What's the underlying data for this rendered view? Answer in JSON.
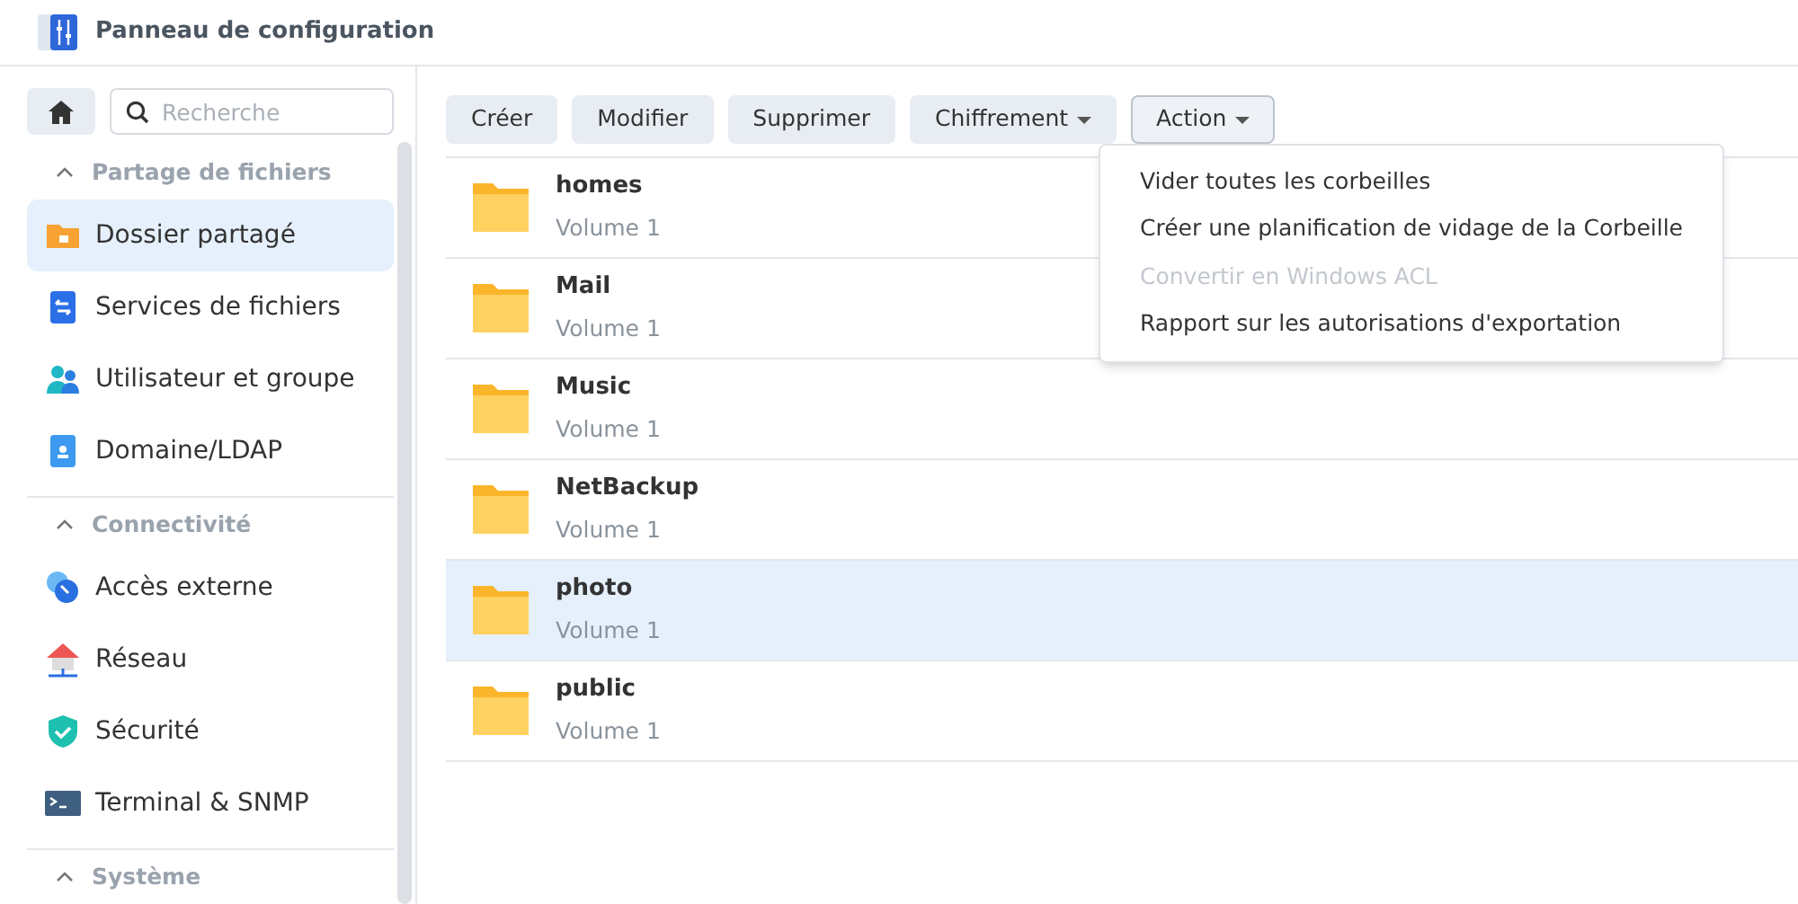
{
  "window": {
    "title": "Panneau de configuration"
  },
  "search": {
    "placeholder": "Recherche"
  },
  "sidebar": {
    "sections": [
      {
        "title": "Partage de fichiers",
        "expanded": true,
        "items": [
          {
            "label": "Dossier partagé",
            "kind": "shared-folder",
            "selected": true
          },
          {
            "label": "Services de fichiers",
            "kind": "file-services",
            "selected": false
          },
          {
            "label": "Utilisateur et groupe",
            "kind": "users",
            "selected": false
          },
          {
            "label": "Domaine/LDAP",
            "kind": "domain",
            "selected": false
          }
        ]
      },
      {
        "title": "Connectivité",
        "expanded": true,
        "items": [
          {
            "label": "Accès externe",
            "kind": "external",
            "selected": false
          },
          {
            "label": "Réseau",
            "kind": "network",
            "selected": false
          },
          {
            "label": "Sécurité",
            "kind": "security",
            "selected": false
          },
          {
            "label": "Terminal & SNMP",
            "kind": "terminal",
            "selected": false
          }
        ]
      },
      {
        "title": "Système",
        "expanded": true
      }
    ]
  },
  "toolbar": [
    {
      "label": "Créer",
      "dropdown": false,
      "open": false
    },
    {
      "label": "Modifier",
      "dropdown": false,
      "open": false
    },
    {
      "label": "Supprimer",
      "dropdown": false,
      "open": false
    },
    {
      "label": "Chiffrement",
      "dropdown": true,
      "open": false
    },
    {
      "label": "Action",
      "dropdown": true,
      "open": true
    }
  ],
  "menu": [
    {
      "label": "Vider toutes les corbeilles",
      "disabled": false
    },
    {
      "label": "Créer une planification de vidage de la Corbeille",
      "disabled": false
    },
    {
      "label": "Convertir en Windows ACL",
      "disabled": true
    },
    {
      "label": "Rapport sur les autorisations d'exportation",
      "disabled": false
    }
  ],
  "folders": [
    {
      "name": "homes",
      "volume": "Volume 1",
      "selected": false
    },
    {
      "name": "Mail",
      "volume": "Volume 1",
      "selected": false
    },
    {
      "name": "Music",
      "volume": "Volume 1",
      "selected": false
    },
    {
      "name": "NetBackup",
      "volume": "Volume 1",
      "selected": false
    },
    {
      "name": "photo",
      "volume": "Volume 1",
      "selected": true
    },
    {
      "name": "public",
      "volume": "Volume 1",
      "selected": false
    }
  ]
}
